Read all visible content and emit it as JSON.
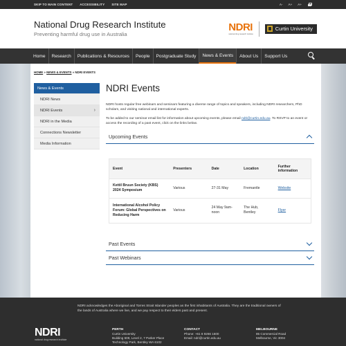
{
  "utility": {
    "skip_link": "SKIP TO MAIN CONTENT",
    "accessibility_link": "ACCESSIBILITY",
    "sitemap_link": "SITE MAP",
    "font_sizes": [
      "A-",
      "A+",
      "A+"
    ],
    "print_icon": "print-icon"
  },
  "header": {
    "title": "National Drug Research Institute",
    "tagline": "Preventing harmful drug use in Australia",
    "ndri_logo_text": "NDRI",
    "ndri_logo_sub": "national drug research institute",
    "curtin_name": "Curtin University"
  },
  "nav": {
    "items": [
      "Home",
      "Research",
      "Publications & Resources",
      "People",
      "Postgraduate Study",
      "News & Events",
      "About Us",
      "Support Us"
    ],
    "active_index": 5,
    "search_icon": "search-icon"
  },
  "breadcrumb": {
    "home": "HOME",
    "section": "NEWS & EVENTS",
    "current": "NDRI EVENTS",
    "separator": "»"
  },
  "sidebar": {
    "heading": "News & Events",
    "items": [
      "NDRI News",
      "NDRI Events",
      "NDRI in the Media",
      "Connections Newsletter",
      "Media Information"
    ],
    "active_index": 1
  },
  "main": {
    "title": "NDRI Events",
    "intro_1": "NDRI hosts regular free webinars and seminars featuring a diverse range of topics and speakers, including NDRI researchers, PhD scholars, and visiting national and international experts.",
    "intro_2_before": "To be added to our seminar email list for information about upcoming events, please email ",
    "intro_2_email": "ndri@curtin.edu.au",
    "intro_2_after": ". To RSVP to an event or access the recording of a past event, click on the links below.",
    "upcoming_label": "Upcoming Events",
    "past_events_label": "Past Events",
    "past_webinars_label": "Past Webinars"
  },
  "events_table": {
    "headers": [
      "Event",
      "Presenters",
      "Date",
      "Location",
      "Further information"
    ],
    "rows": [
      {
        "event": "Kettil Bruun Society (KBS) 2024 Symposium",
        "presenters": "Various",
        "date": "27-31 May",
        "location": "Fremantle",
        "info": "Website"
      },
      {
        "event": "International Alcohol Policy Forum: Global Perspectives on Reducing Harm",
        "presenters": "Various",
        "date": "24 May 9am-noon",
        "location": "The Hub, Bentley",
        "info": "Flyer"
      }
    ]
  },
  "footer": {
    "acknowledgement": "NDRI acknowledges the Aboriginal and Torres Strait Islander peoples as the first inhabitants of Australia. They are the traditional owners of the lands of Australia where we live, and we pay respect to their elders past and present.",
    "logo_text": "NDRI",
    "logo_sub": "national drug research institute",
    "perth": {
      "head": "PERTH",
      "lines": [
        "Curtin University",
        "Building 609, Level 2, 7 Parker Place",
        "Technology Park, Bentley WA 6102"
      ]
    },
    "contact": {
      "head": "CONTACT",
      "lines": [
        "Phone: +61 8 9266 1600",
        "Email: ndri@curtin.edu.au"
      ]
    },
    "melbourne": {
      "head": "MELBOURNE",
      "lines": [
        "85 Commercial Road",
        "Melbourne, Vic 3004"
      ]
    }
  }
}
